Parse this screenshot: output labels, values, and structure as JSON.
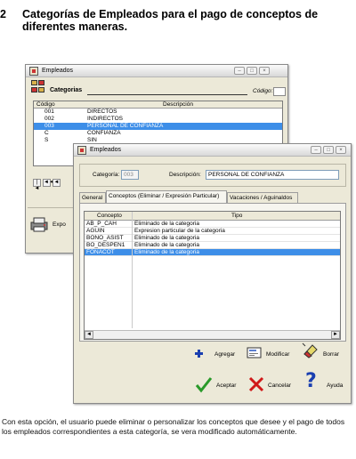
{
  "heading": {
    "number": "2",
    "text": "Categorías de Empleados para el pago de  conceptos de diferentes maneras."
  },
  "back_window": {
    "title": "Empleados",
    "category_label": "Categorias",
    "codigo_label": "Código:",
    "columns": [
      "Código",
      "Descripción"
    ],
    "rows": [
      {
        "codigo": "001",
        "descripcion": "DIRECTOS"
      },
      {
        "codigo": "002",
        "descripcion": "INDIRECTOS"
      },
      {
        "codigo": "003",
        "descripcion": "PERSONAL DE CONFIANZA",
        "selected": true
      },
      {
        "codigo": "C",
        "descripcion": "CONFIANZA"
      },
      {
        "codigo": "S",
        "descripcion": "SIN"
      }
    ],
    "nav": [
      "|◄",
      "◄◄",
      "◄"
    ],
    "export_label": "Expo"
  },
  "front_window": {
    "title": "Empleados",
    "categoria_label": "Categoría:",
    "categoria_value": "003",
    "descripcion_label": "Descripción:",
    "descripcion_value": "PERSONAL DE CONFIANZA",
    "tabs": [
      {
        "label": "General"
      },
      {
        "label": "Conceptos (Eliminar / Expresión Particular)"
      },
      {
        "label": "Vacaciones / Aguinaldos"
      }
    ],
    "columns": [
      "Concepto",
      "Tipo"
    ],
    "rows": [
      {
        "concepto": "AB_P_CAH",
        "tipo": "Eliminado de la categoria"
      },
      {
        "concepto": "AGUIN",
        "tipo": "Expresion particular de la categoria"
      },
      {
        "concepto": "BONO_ASIST",
        "tipo": "Eliminado de la categoria"
      },
      {
        "concepto": "BO_DESPEN1",
        "tipo": "Eliminado de la categoria"
      },
      {
        "concepto": "FONACOT",
        "tipo": "Eliminado de la categoria",
        "selected": true
      }
    ],
    "actions": {
      "agregar": "Agregar",
      "modificar": "Modificar",
      "borrar": "Borrar"
    },
    "buttons": {
      "aceptar": "Aceptar",
      "cancelar": "Cancelar",
      "ayuda": "Ayuda"
    }
  },
  "paragraph": "Con esta opción, el usuario puede eliminar o personalizar los conceptos que desee y el pago de todos los empleados correspondientes a esta categoría, se vera modificado automáticamente.",
  "colors": {
    "selection": "#3d8ee8",
    "window_bg": "#ece9d8",
    "accept_green": "#2a9a2a",
    "cancel_red": "#d01818",
    "help_blue": "#1a3fb0"
  }
}
